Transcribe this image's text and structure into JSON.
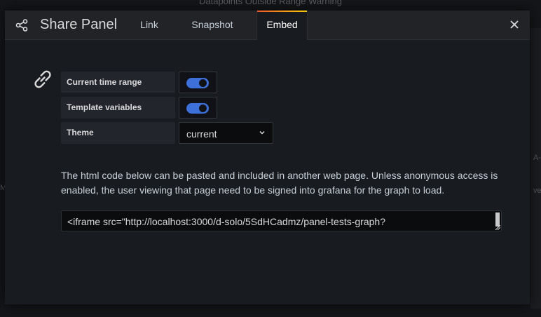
{
  "background": {
    "title": "Datapoints Outside Range Warning",
    "right_label_1": "A-",
    "right_label_2": "ve",
    "left_label": "M"
  },
  "header": {
    "title": "Share Panel",
    "icon": "share-icon",
    "tabs": [
      {
        "label": "Link",
        "active": false
      },
      {
        "label": "Snapshot",
        "active": false
      },
      {
        "label": "Embed",
        "active": true
      }
    ],
    "close_icon": "close-icon"
  },
  "options": {
    "icon": "link-icon",
    "current_time_range": {
      "label": "Current time range",
      "enabled": true
    },
    "template_variables": {
      "label": "Template variables",
      "enabled": true
    },
    "theme": {
      "label": "Theme",
      "value": "current"
    }
  },
  "description": "The html code below can be pasted and included in another web page. Unless anonymous access is enabled, the user viewing that page need to be signed into grafana for the graph to load.",
  "embed_code": "<iframe src=\"http://localhost:3000/d-solo/5SdHCadmz/panel-tests-graph?",
  "colors": {
    "accent": "#3d71d9",
    "tab_gradient_start": "#f05a28",
    "tab_gradient_end": "#fbca0a"
  }
}
